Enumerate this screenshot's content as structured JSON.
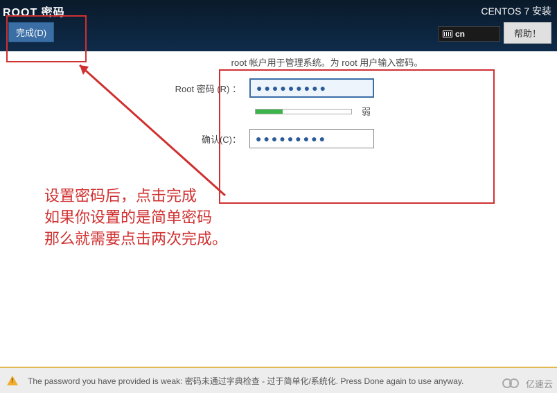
{
  "header": {
    "title": "ROOT 密码",
    "subtitle": "CENTOS 7 安装",
    "done_label": "完成(D)",
    "help_label": "帮助！",
    "lang_code": "cn"
  },
  "form": {
    "hint": "root 帐户用于管理系统。为 root 用户输入密码。",
    "password_label": "Root 密码 (R) ：",
    "password_value": "●●●●●●●●●",
    "confirm_label": "确认(C)：",
    "confirm_value": "●●●●●●●●●",
    "strength_text": "弱",
    "strength_fill_percent": 28,
    "strength_color": "#3bb44a"
  },
  "footer": {
    "message": "The password you have provided is weak: 密码未通过字典检查 - 过于简单化/系统化. Press Done again to use anyway."
  },
  "annotation": {
    "line1": "设置密码后，点击完成",
    "line2": "如果你设置的是简单密码",
    "line3": "那么就需要点击两次完成。"
  },
  "watermark": {
    "text": "亿速云"
  }
}
